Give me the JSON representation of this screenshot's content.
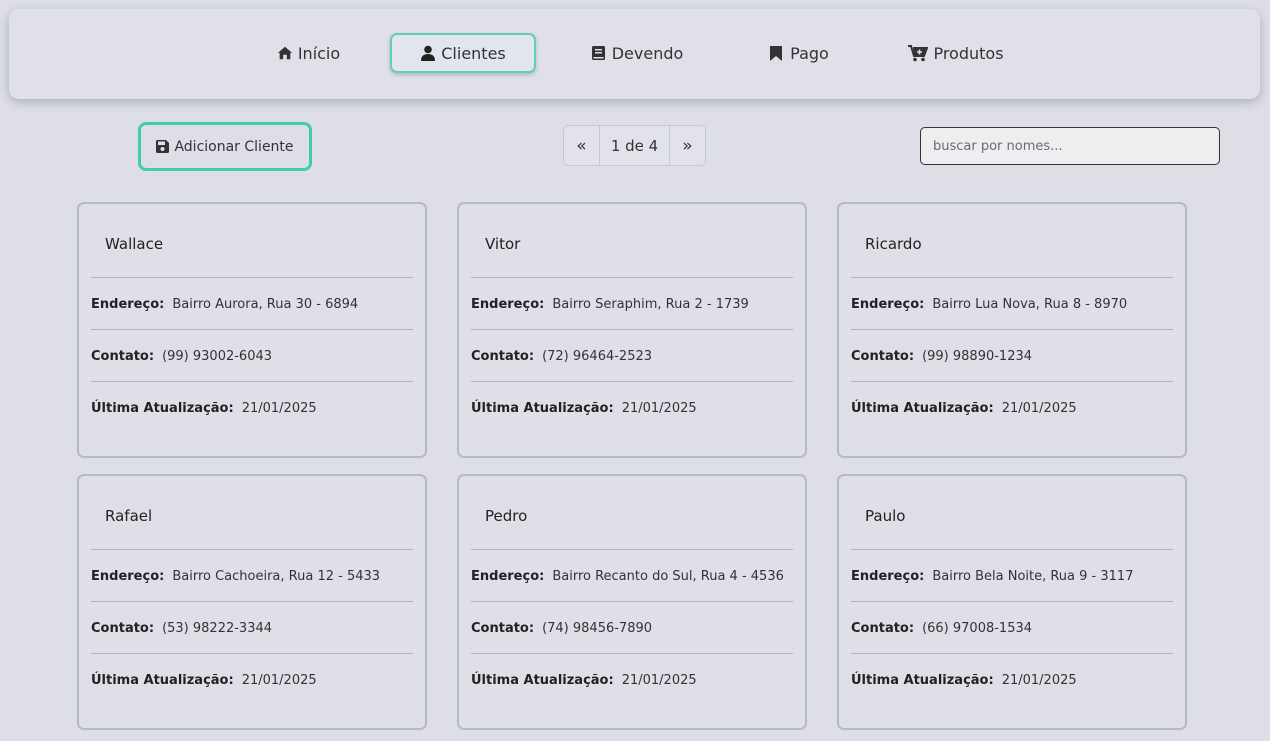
{
  "nav": {
    "items": [
      {
        "label": "Início",
        "icon": "home-icon"
      },
      {
        "label": "Clientes",
        "icon": "user-icon",
        "active": true
      },
      {
        "label": "Devendo",
        "icon": "book-icon"
      },
      {
        "label": "Pago",
        "icon": "bookmark-icon"
      },
      {
        "label": "Produtos",
        "icon": "cart-plus-icon"
      }
    ]
  },
  "toolbar": {
    "add_label": "Adicionar Cliente",
    "add_icon": "save-icon",
    "pager": {
      "prev": "«",
      "current": "1 de 4",
      "next": "»"
    },
    "search_placeholder": "buscar por nomes..."
  },
  "labels": {
    "address": "Endereço:",
    "contact": "Contato:",
    "updated": "Última Atualização:"
  },
  "clients": [
    {
      "name": "Wallace",
      "address": "Bairro Aurora, Rua 30 - 6894",
      "contact": "(99) 93002-6043",
      "updated": "21/01/2025"
    },
    {
      "name": "Vitor",
      "address": "Bairro Seraphim, Rua 2 - 1739",
      "contact": "(72) 96464-2523",
      "updated": "21/01/2025"
    },
    {
      "name": "Ricardo",
      "address": "Bairro Lua Nova, Rua 8 - 8970",
      "contact": "(99) 98890-1234",
      "updated": "21/01/2025"
    },
    {
      "name": "Rafael",
      "address": "Bairro Cachoeira, Rua 12 - 5433",
      "contact": "(53) 98222-3344",
      "updated": "21/01/2025"
    },
    {
      "name": "Pedro",
      "address": "Bairro Recanto do Sul, Rua 4 - 4536",
      "contact": "(74) 98456-7890",
      "updated": "21/01/2025"
    },
    {
      "name": "Paulo",
      "address": "Bairro Bela Noite, Rua 9 - 3117",
      "contact": "(66) 97008-1534",
      "updated": "21/01/2025"
    }
  ],
  "colors": {
    "accent": "#3fcfa7",
    "background": "#dddee6"
  }
}
